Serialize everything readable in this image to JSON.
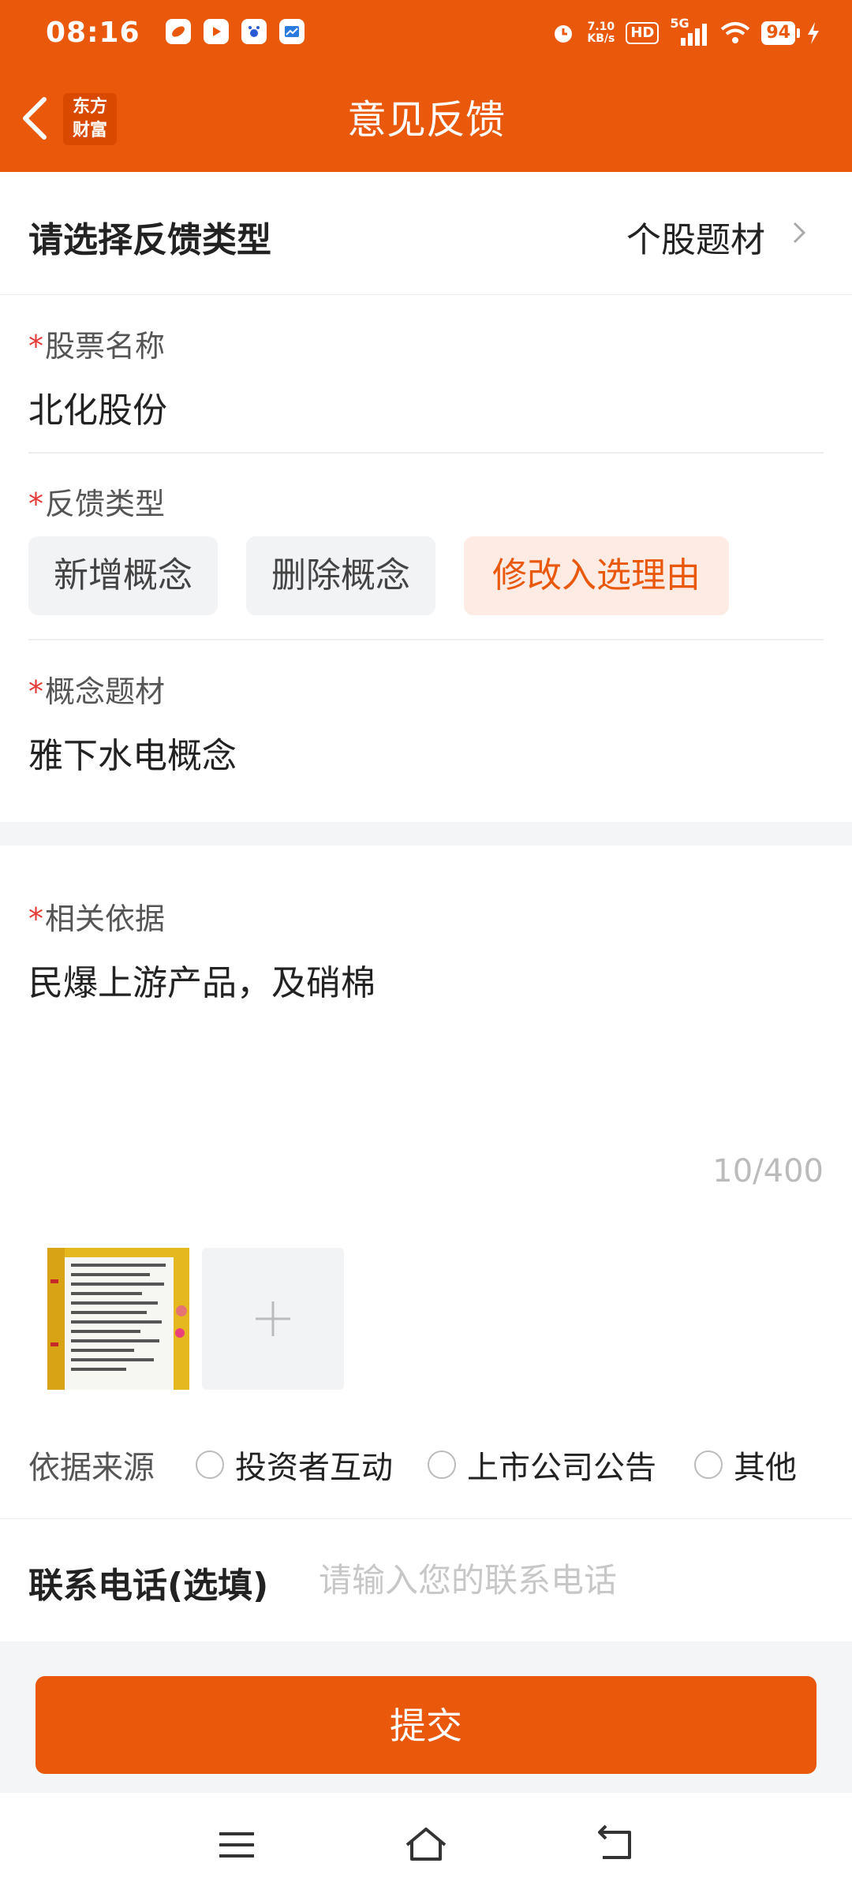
{
  "status_bar": {
    "time": "08:16",
    "net_speed_value": "7.10",
    "net_speed_unit": "KB/s",
    "hd_label": "HD",
    "network": "5G",
    "battery": "94"
  },
  "nav": {
    "logo_line1": "东方",
    "logo_line2": "财富",
    "title": "意见反馈"
  },
  "feedback_category": {
    "label": "请选择反馈类型",
    "value": "个股题材"
  },
  "stock_name": {
    "required_mark": "*",
    "label": "股票名称",
    "value": "北化股份"
  },
  "feedback_type": {
    "required_mark": "*",
    "label": "反馈类型",
    "options": [
      "新增概念",
      "删除概念",
      "修改入选理由"
    ],
    "selected": "修改入选理由"
  },
  "concept": {
    "required_mark": "*",
    "label": "概念题材",
    "value": "雅下水电概念"
  },
  "basis": {
    "required_mark": "*",
    "label": "相关依据",
    "value": "民爆上游产品，及硝棉",
    "counter": "10/400"
  },
  "source": {
    "label": "依据来源",
    "options": [
      "投资者互动",
      "上市公司公告",
      "其他"
    ]
  },
  "phone": {
    "label": "联系电话(选填)",
    "placeholder": "请输入您的联系电话"
  },
  "submit_label": "提交",
  "colors": {
    "brand": "#ea580c",
    "required": "#e53935",
    "chip_active_bg": "#fdebe4"
  }
}
